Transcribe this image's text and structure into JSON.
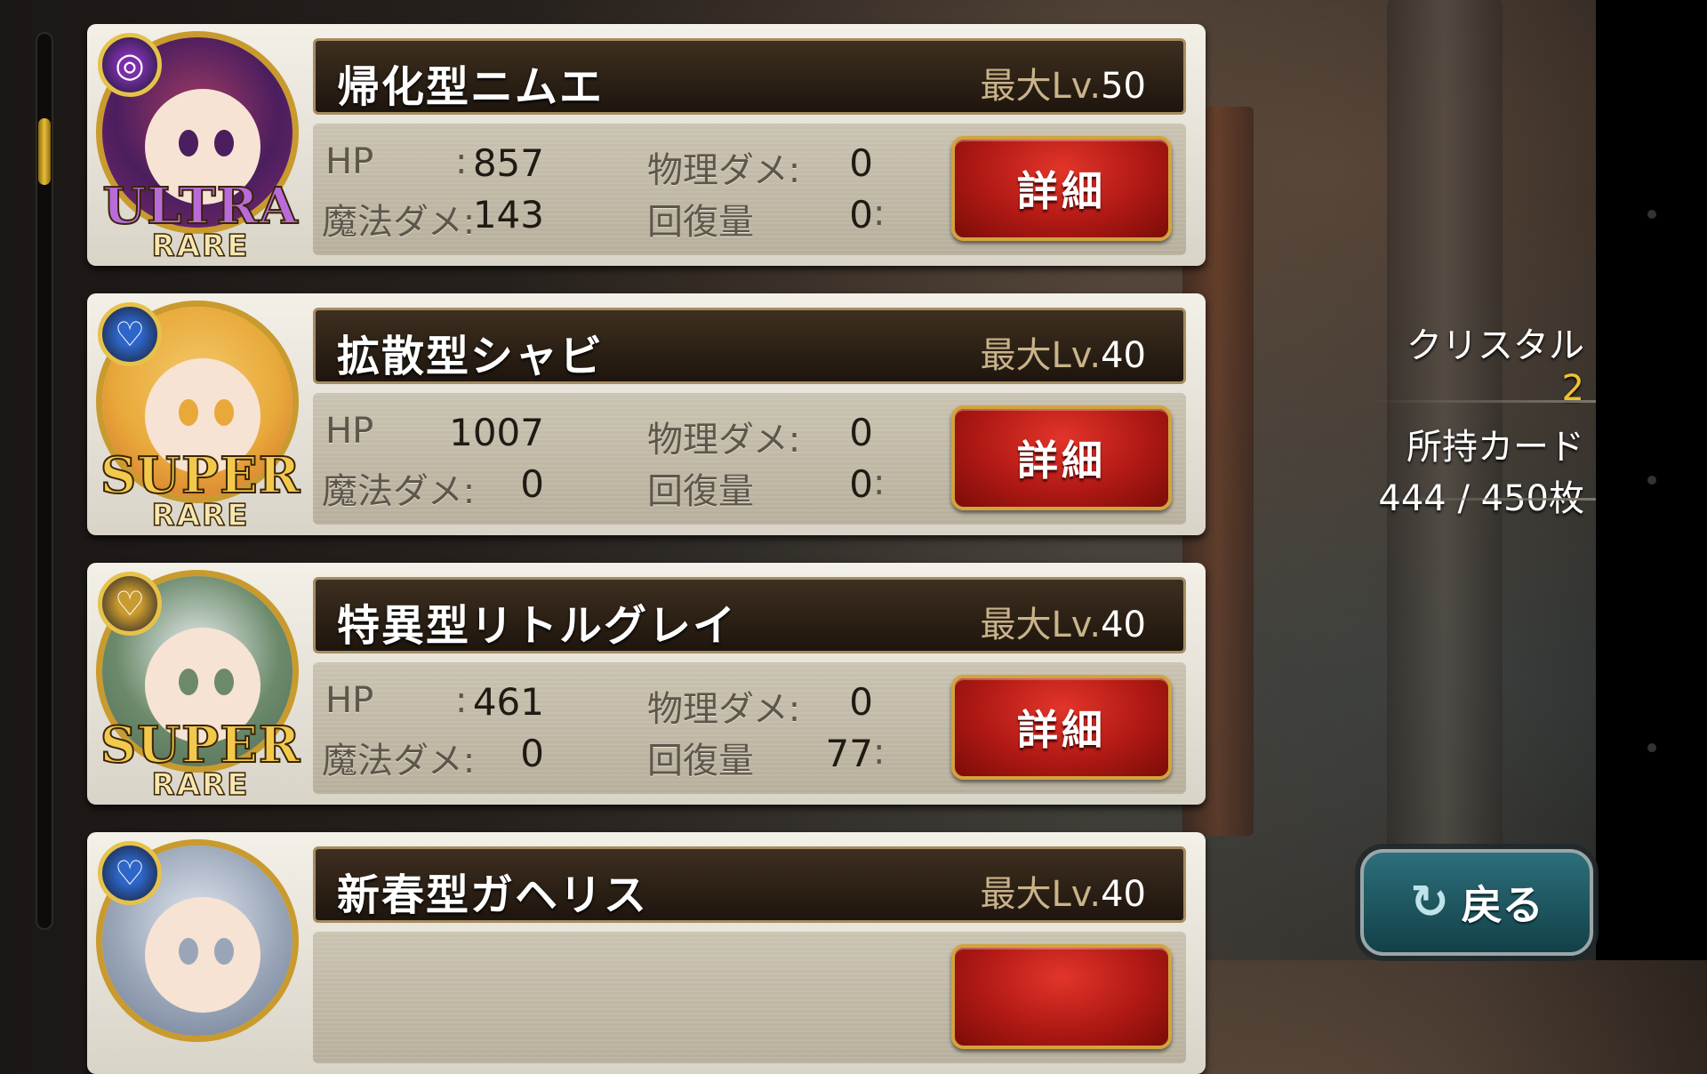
{
  "cards": [
    {
      "name": "帰化型ニムエ",
      "level_label": "最大Lv.",
      "level_value": "50",
      "hp_label": "HP",
      "hp": "857",
      "physical_label": "物理ダメ:",
      "physical": "0",
      "magic_label": "魔法ダメ:",
      "magic": "143",
      "heal_label": "回復量",
      "heal": "0",
      "detail_label": "詳細",
      "rarity_top": "ULTRA",
      "rarity_bottom": "RARE",
      "rarity_color": "#b96bd9",
      "attribute_icon": "spiral-icon",
      "attribute_color": "#7a2ea8",
      "portrait_colors": [
        "#4b1e5e",
        "#a23b63",
        "#7d2a6e"
      ]
    },
    {
      "name": "拡散型シャビ",
      "level_label": "最大Lv.",
      "level_value": "40",
      "hp_label": "HP",
      "hp": "1007",
      "physical_label": "物理ダメ:",
      "physical": "0",
      "magic_label": "魔法ダメ:",
      "magic": "0",
      "heal_label": "回復量",
      "heal": "0",
      "detail_label": "詳細",
      "rarity_top": "SUPER",
      "rarity_bottom": "RARE",
      "rarity_color": "#f2c94c",
      "attribute_icon": "heart-crown-icon",
      "attribute_color": "#2d66c8",
      "portrait_colors": [
        "#e8a93a",
        "#f4c96a",
        "#d26b2b"
      ]
    },
    {
      "name": "特異型リトルグレイ",
      "level_label": "最大Lv.",
      "level_value": "40",
      "hp_label": "HP",
      "hp": "461",
      "physical_label": "物理ダメ:",
      "physical": "0",
      "magic_label": "魔法ダメ:",
      "magic": "0",
      "heal_label": "回復量",
      "heal": "77",
      "detail_label": "詳細",
      "rarity_top": "SUPER",
      "rarity_bottom": "RARE",
      "rarity_color": "#f2c94c",
      "attribute_icon": "heart-crown-icon",
      "attribute_color": "#c99a2e",
      "portrait_colors": [
        "#6c8a6b",
        "#e9eef0",
        "#4f6b57"
      ]
    },
    {
      "name": "新春型ガヘリス",
      "level_label": "最大Lv.",
      "level_value": "40",
      "hp_label": "HP",
      "hp": "",
      "physical_label": "",
      "physical": "",
      "magic_label": "",
      "magic": "",
      "heal_label": "",
      "heal": "",
      "detail_label": "",
      "rarity_top": "",
      "rarity_bottom": "",
      "rarity_color": "#f2c94c",
      "attribute_icon": "heart-crown-icon",
      "attribute_color": "#2d66c8",
      "portrait_colors": [
        "#9aa6b8",
        "#dfe5ee",
        "#6e7a90"
      ]
    }
  ],
  "side": {
    "crystal_label": "クリスタル",
    "crystal_value": "2",
    "cards_label": "所持カード",
    "cards_value": "444 / 450枚"
  },
  "back_button": {
    "label": "戻る",
    "icon": "return-arrow-icon"
  },
  "scrollbar": {
    "position_fraction": 0.1
  }
}
